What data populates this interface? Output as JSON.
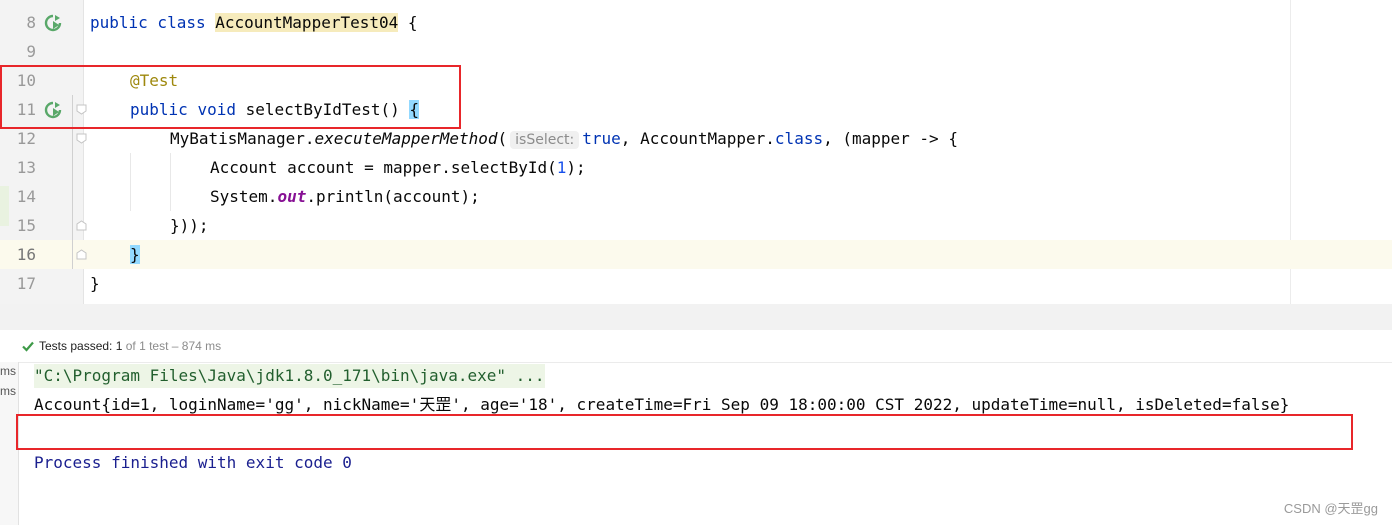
{
  "editor": {
    "lines": [
      {
        "n": "8"
      },
      {
        "n": "9"
      },
      {
        "n": "10"
      },
      {
        "n": "11"
      },
      {
        "n": "12"
      },
      {
        "n": "13"
      },
      {
        "n": "14"
      },
      {
        "n": "15"
      },
      {
        "n": "16"
      },
      {
        "n": "17"
      }
    ],
    "code": {
      "l8_kw": "public class ",
      "l8_cls": "AccountMapperTest04",
      "l8_rest": " {",
      "l10_ann": "@Test",
      "l11_kw1": "public",
      "l11_kw2": "void",
      "l11_name": " selectByIdTest() ",
      "l11_brace": "{",
      "l12_a": "MyBatisManager.",
      "l12_method": "executeMapperMethod",
      "l12_paren": "(",
      "l12_hint": "isSelect:",
      "l12_true": "true",
      "l12_b": ", AccountMapper.",
      "l12_class": "class",
      "l12_c": ", (mapper -> {",
      "l13_a": "Account account = mapper.selectById(",
      "l13_num": "1",
      "l13_b": ");",
      "l14_a": "System.",
      "l14_field": "out",
      "l14_b": ".println(account);",
      "l15": "}));",
      "l16": "}",
      "l17": "}"
    }
  },
  "run_panel": {
    "status_label": "Tests passed:",
    "status_count": "1",
    "status_detail": "of 1 test – 874 ms",
    "tree_ms_1": "ms",
    "tree_ms_2": "ms",
    "console": {
      "command": "\"C:\\Program Files\\Java\\jdk1.8.0_171\\bin\\java.exe\" ...",
      "output": "Account{id=1, loginName='gg', nickName='天罡', age='18', createTime=Fri Sep 09 18:00:00 CST 2022, updateTime=null, isDeleted=false}",
      "finished": "Process finished with exit code 0"
    }
  },
  "watermark": "CSDN @天罡gg",
  "colors": {
    "keyword": "#0033b3",
    "annotation": "#9e880d",
    "highlight_box": "#e8262a",
    "run_icon": "#59a869"
  }
}
